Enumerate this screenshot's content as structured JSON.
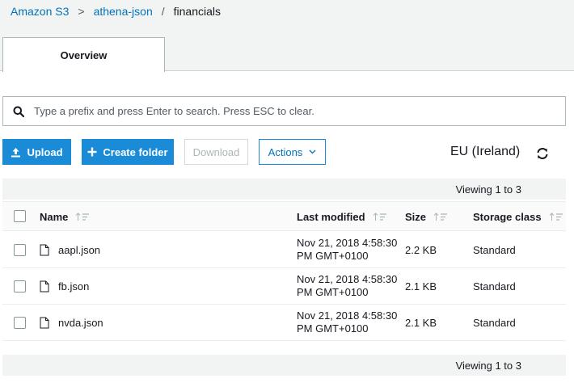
{
  "breadcrumb": {
    "root": "Amazon S3",
    "bucket": "athena-json",
    "separator_1": ">",
    "separator_2": "/",
    "folder": "financials"
  },
  "tabs": [
    {
      "label": "Overview",
      "active": true
    }
  ],
  "search": {
    "placeholder": "Type a prefix and press Enter to search. Press ESC to clear.",
    "value": ""
  },
  "toolbar": {
    "upload_label": "Upload",
    "create_folder_label": "Create folder",
    "download_label": "Download",
    "actions_label": "Actions",
    "region": "EU (Ireland)"
  },
  "pagination": {
    "top": "Viewing 1 to 3",
    "bottom": "Viewing 1 to 3"
  },
  "table": {
    "columns": {
      "name": "Name",
      "last_modified": "Last modified",
      "size": "Size",
      "storage_class": "Storage class"
    },
    "rows": [
      {
        "name": "aapl.json",
        "modified_1": "Nov 21, 2018 4:58:30",
        "modified_2": "PM GMT+0100",
        "size": "2.2 KB",
        "storage_class": "Standard"
      },
      {
        "name": "fb.json",
        "modified_1": "Nov 21, 2018 4:58:30",
        "modified_2": "PM GMT+0100",
        "size": "2.1 KB",
        "storage_class": "Standard"
      },
      {
        "name": "nvda.json",
        "modified_1": "Nov 21, 2018 4:58:30",
        "modified_2": "PM GMT+0100",
        "size": "2.1 KB",
        "storage_class": "Standard"
      }
    ]
  },
  "icons": {
    "search": "search-icon",
    "upload": "upload-icon",
    "create": "plus-icon",
    "actions": "chevron-down-icon",
    "refresh": "refresh-icon",
    "file": "file-icon",
    "sort": "sort-icon"
  },
  "colors": {
    "primary": "#1a8bd6",
    "link": "#0073bb",
    "band": "#f2f3f3"
  }
}
